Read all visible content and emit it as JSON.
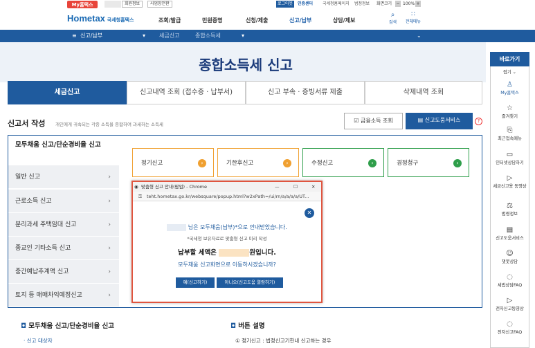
{
  "util": {
    "my_hometax": "My홈택스",
    "user_info": "회원정보",
    "biz_cert": "사업장전환",
    "logout": "로그아웃",
    "cert_center": "인증센터",
    "site1": "국세청홈페이지",
    "site2": "범정정보",
    "screen": "화면크기",
    "zoom": "100%"
  },
  "logo": {
    "brand": "Hometax",
    "sub": "국세청홈택스"
  },
  "gnb": [
    "조회/발급",
    "민원증명",
    "신청/제출",
    "신고/납부",
    "상담/제보"
  ],
  "tools": {
    "search": "검색",
    "all_menu": "전체메뉴"
  },
  "nav": {
    "menu": "신고/납부",
    "crumb1": "세금신고",
    "crumb2": "종합소득세"
  },
  "title": "종합소득세 신고",
  "tabs": [
    "세금신고",
    "신고내역 조회 (접수증 · 납부서)",
    "신고 부속 · 증빙서류 제출",
    "삭제내역 조회"
  ],
  "section": {
    "title": "신고서 작성",
    "desc": "개인에게 귀속되는 각종 소득을 종합하여 과세하는 소득세",
    "btn_financial": "금융소득 조회",
    "btn_service": "신고도움서비스"
  },
  "left_active": "모두채움 신고/단순경비율 신고",
  "left_items": [
    "일반 신고",
    "근로소득 신고",
    "분리과세 주택임대 신고",
    "종교인 기타소득 신고",
    "중간예납추계액 신고",
    "토지 등 매매차익예정신고"
  ],
  "types": [
    "정기신고",
    "기한후신고",
    "수정신고",
    "경정청구"
  ],
  "popup": {
    "window_title": "맞춤형 신고 안내(팝업) - Chrome",
    "url": "teht.hometax.go.kr/websquare/popup.html?w2xPath=/ui/rn/a/a/a/a/UT...",
    "line1": "님은 모두채움(납부)*으로 안내받았습니다.",
    "line2": "*국세청 보유자료로 맞춤형 신고 미리 작성",
    "line3a": "납부할 세액은",
    "line3b": "원입니다.",
    "line4": "모두채움 신고화면으로 이동하시겠습니까?",
    "yes": "예(신고하기)",
    "no": "아니오(신고도움 열람하기)"
  },
  "bottom": {
    "left_title": "모두채움 신고/단순경비율 신고",
    "left_sub": "신고 대상자",
    "right_title": "버튼 설명",
    "right_sub": "① 정기신고 : 법정신고기한내 신고하는 경우"
  },
  "rside": {
    "head": "바로가기",
    "fold": "접기",
    "items": [
      "My홈택스",
      "즐겨찾기",
      "최근접속메뉴",
      "인터넷상담하기",
      "세금신고용 동영상",
      "법령정보",
      "신고도움서비스",
      "챗봇상담",
      "세법상담FAQ",
      "전자신고동영상",
      "전자신고FAQ"
    ]
  },
  "colors": {
    "brand": "#1f5b9e",
    "accent_orange": "#f0a030",
    "accent_green": "#2e9e4a",
    "popup_border": "#e0553f"
  }
}
